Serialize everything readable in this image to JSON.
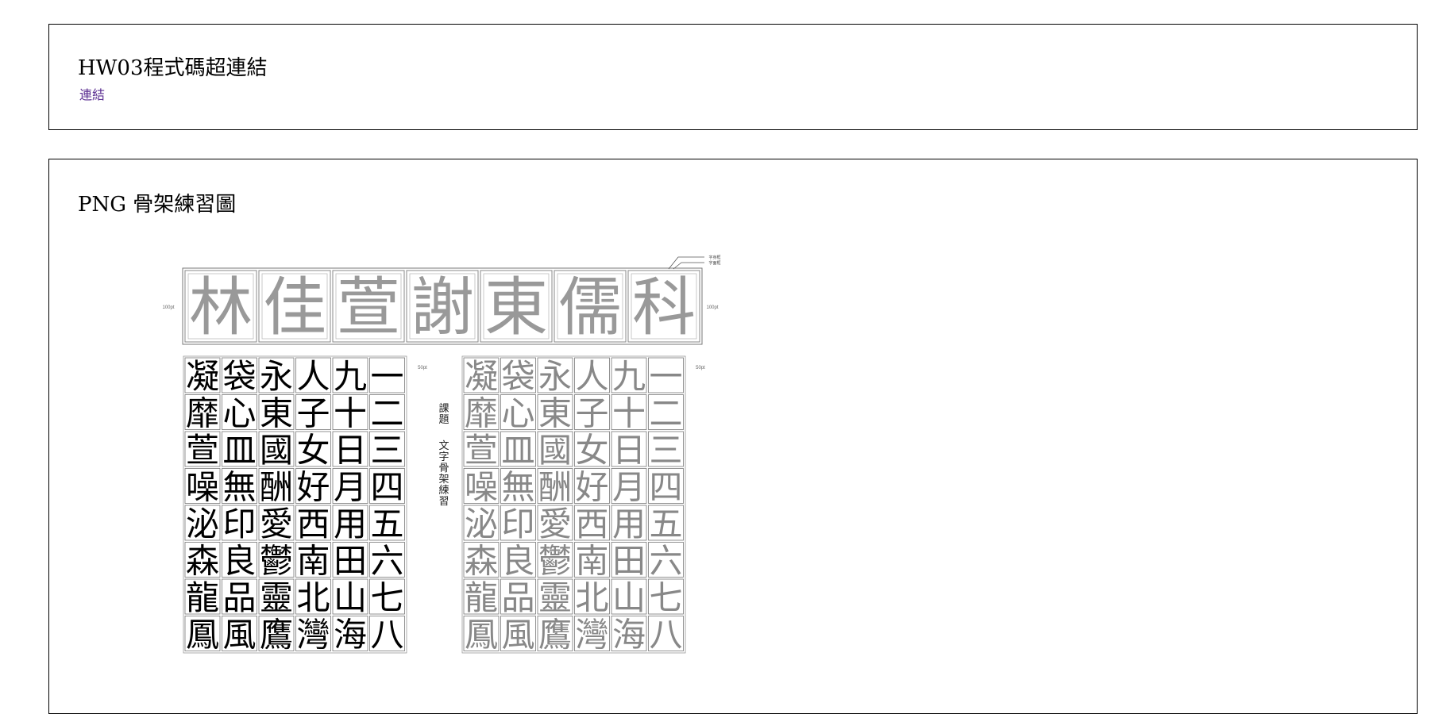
{
  "cards": {
    "hw03": {
      "title": "HW03程式碼超連結",
      "link_label": "連結"
    },
    "png": {
      "title": "PNG 骨架練習圖"
    }
  },
  "worksheet": {
    "name_chars": [
      "林",
      "佳",
      "萱",
      "謝",
      "東",
      "儒",
      "科"
    ],
    "left_size_note": "100pt",
    "right_size_note": "100pt",
    "top_callouts": [
      "字身框",
      "字面框"
    ],
    "grid_size_note_left": "50pt",
    "grid_size_note_right": "50pt",
    "subject_label": "課題",
    "subject_text": "文字骨架練習",
    "grid_rows": [
      [
        "凝",
        "袋",
        "永",
        "人",
        "九",
        "一"
      ],
      [
        "靡",
        "心",
        "東",
        "子",
        "十",
        "二"
      ],
      [
        "萱",
        "皿",
        "國",
        "女",
        "日",
        "三"
      ],
      [
        "噪",
        "無",
        "酬",
        "好",
        "月",
        "四"
      ],
      [
        "泌",
        "印",
        "愛",
        "西",
        "用",
        "五"
      ],
      [
        "森",
        "良",
        "鬱",
        "南",
        "田",
        "六"
      ],
      [
        "龍",
        "品",
        "靈",
        "北",
        "山",
        "七"
      ],
      [
        "鳳",
        "風",
        "鷹",
        "灣",
        "海",
        "八"
      ]
    ]
  }
}
